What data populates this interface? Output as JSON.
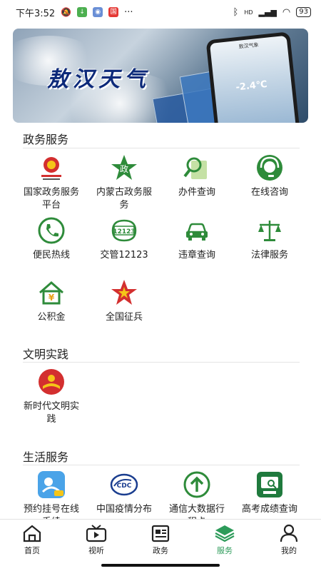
{
  "status_bar": {
    "time": "下午3:52",
    "signal": "HD",
    "battery": "93"
  },
  "banner": {
    "title": "敖汉天气",
    "phone_app_title": "敖汉气象",
    "phone_temp": "-2.4℃"
  },
  "sections": [
    {
      "title": "政务服务",
      "items": [
        {
          "label": "国家政务服务平台",
          "icon": "national-emblem-icon"
        },
        {
          "label": "内蒙古政务服务",
          "icon": "gov-star-icon"
        },
        {
          "label": "办件查询",
          "icon": "search-document-icon"
        },
        {
          "label": "在线咨询",
          "icon": "customer-service-icon"
        },
        {
          "label": "便民热线",
          "icon": "phone-icon"
        },
        {
          "label": "交管12123",
          "icon": "traffic-12123-icon"
        },
        {
          "label": "违章查询",
          "icon": "car-icon"
        },
        {
          "label": "法律服务",
          "icon": "scales-icon"
        },
        {
          "label": "公积金",
          "icon": "house-fund-icon"
        },
        {
          "label": "全国征兵",
          "icon": "military-star-icon"
        }
      ]
    },
    {
      "title": "文明实践",
      "items": [
        {
          "label": "新时代文明实践",
          "icon": "civilization-practice-icon"
        }
      ]
    },
    {
      "title": "生活服务",
      "items": [
        {
          "label": "预约挂号在线手续",
          "icon": "appointment-icon"
        },
        {
          "label": "中国疫情分布",
          "icon": "cdc-map-icon"
        },
        {
          "label": "通信大数据行程卡",
          "icon": "up-arrow-circle-icon"
        },
        {
          "label": "高考成绩查询",
          "icon": "exam-search-icon"
        }
      ]
    }
  ],
  "tabs": [
    {
      "label": "首页",
      "icon": "home-icon",
      "active": false
    },
    {
      "label": "视听",
      "icon": "video-icon",
      "active": false
    },
    {
      "label": "政务",
      "icon": "news-icon",
      "active": false
    },
    {
      "label": "服务",
      "icon": "layers-icon",
      "active": true
    },
    {
      "label": "我的",
      "icon": "user-icon",
      "active": false
    }
  ],
  "colors": {
    "accent_green": "#2d9b5a",
    "banner_title": "#0d2a7a"
  }
}
